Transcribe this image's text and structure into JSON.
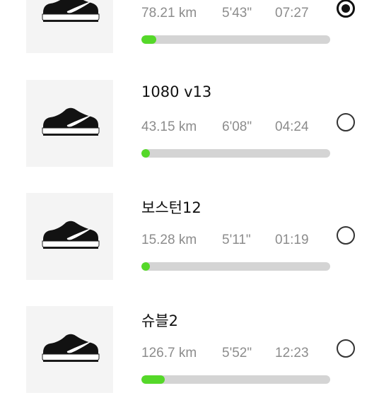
{
  "shoes": [
    {
      "name": "",
      "distance": "78.21 km",
      "pace": "5'43\"",
      "time": "07:27",
      "progress": 0.08,
      "selected": true
    },
    {
      "name": "1080 v13",
      "distance": "43.15 km",
      "pace": "6'08\"",
      "time": "04:24",
      "progress": 0.045,
      "selected": false
    },
    {
      "name": "보스턴12",
      "distance": "15.28 km",
      "pace": "5'11\"",
      "time": "01:19",
      "progress": 0.04,
      "selected": false
    },
    {
      "name": "슈블2",
      "distance": "126.7 km",
      "pace": "5'52\"",
      "time": "12:23",
      "progress": 0.125,
      "selected": false
    }
  ],
  "icons": {
    "shoe": "running-shoe-icon",
    "radio": "radio-button"
  },
  "colors": {
    "progress_fill": "#55d829",
    "progress_track": "#d4d4d4",
    "stat_text": "#8c8c8c"
  }
}
